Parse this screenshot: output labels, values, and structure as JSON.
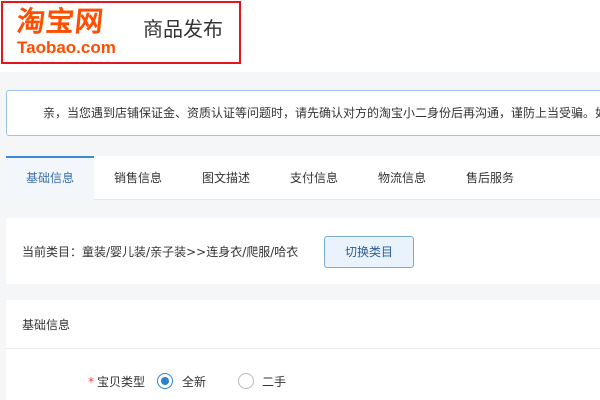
{
  "header": {
    "logo_cn": "淘宝网",
    "logo_en": "Taobao.com",
    "page_title": "商品发布"
  },
  "notice": {
    "text": "亲，当您遇到店铺保证金、资质认证等问题时，请先确认对方的淘宝小二身份后再沟通，谨防上当受骗。如"
  },
  "tabs": [
    {
      "label": "基础信息",
      "active": true
    },
    {
      "label": "销售信息",
      "active": false
    },
    {
      "label": "图文描述",
      "active": false
    },
    {
      "label": "支付信息",
      "active": false
    },
    {
      "label": "物流信息",
      "active": false
    },
    {
      "label": "售后服务",
      "active": false
    }
  ],
  "category": {
    "text": "当前类目：童装/婴儿装/亲子装>>连身衣/爬服/哈衣",
    "switch_label": "切换类目"
  },
  "basic": {
    "title": "基础信息",
    "item_type_label": "宝贝类型",
    "required_mark": "*",
    "options": [
      {
        "label": "全新",
        "selected": true
      },
      {
        "label": "二手",
        "selected": false
      }
    ]
  },
  "colors": {
    "brand_orange": "#ff4e00",
    "logo_border": "#e4151e",
    "accent_blue": "#3b8bd5",
    "required_red": "#ff3b30"
  }
}
